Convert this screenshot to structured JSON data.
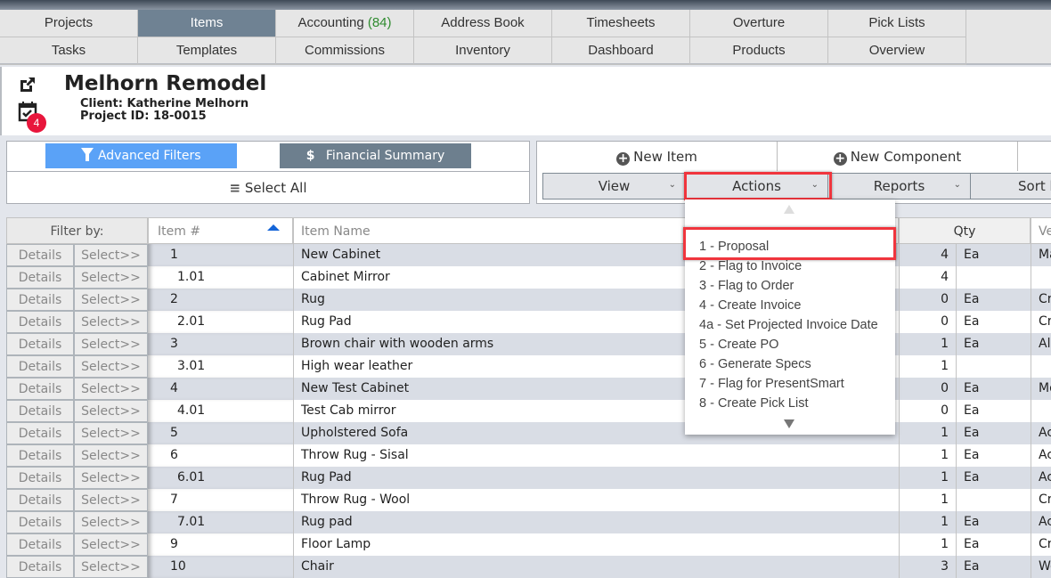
{
  "nav": {
    "row1": [
      {
        "label": "Projects",
        "active": false
      },
      {
        "label": "Items",
        "active": true
      },
      {
        "label": "Accounting",
        "count": "(84)",
        "active": false
      },
      {
        "label": "Address Book",
        "active": false
      },
      {
        "label": "Timesheets",
        "active": false
      },
      {
        "label": "Overture",
        "active": false
      },
      {
        "label": "Pick Lists",
        "active": false
      }
    ],
    "row2": [
      {
        "label": "Tasks"
      },
      {
        "label": "Templates"
      },
      {
        "label": "Commissions"
      },
      {
        "label": "Inventory"
      },
      {
        "label": "Dashboard"
      },
      {
        "label": "Products"
      },
      {
        "label": "Overview"
      }
    ]
  },
  "project": {
    "title": "Melhorn Remodel",
    "client": "Client: Katherine Melhorn",
    "project_id": "Project ID: 18-0015",
    "task_badge": "4"
  },
  "toolbar": {
    "advanced_filters": "Advanced Filters",
    "financial_summary": "Financial Summary",
    "select_all": "Select All",
    "new_item": "New Item",
    "new_component": "New Component",
    "view": "View",
    "actions": "Actions",
    "reports": "Reports",
    "sort_by": "Sort by"
  },
  "actions_menu": {
    "items": [
      "1 - Proposal",
      "2 - Flag to Invoice",
      "3 - Flag to Order",
      "4 - Create Invoice",
      "4a - Set Projected Invoice Date",
      "5 - Create PO",
      "6 - Generate Specs",
      "7 - Flag for PresentSmart",
      "8 - Create Pick List"
    ],
    "highlighted": "1 - Proposal"
  },
  "table": {
    "filter_label": "Filter by:",
    "headers": {
      "item_no": "Item #",
      "item_name": "Item Name",
      "qty": "Qty",
      "vendor": "Ve"
    },
    "details_label": "Details",
    "select_label": "Select>>",
    "rows": [
      {
        "no": "1",
        "name": "New Cabinet",
        "qty": "4",
        "unit": "Ea",
        "vendor": "Ma"
      },
      {
        "no": "1.01",
        "name": "Cabinet Mirror",
        "qty": "4",
        "unit": "",
        "vendor": ""
      },
      {
        "no": "2",
        "name": "Rug",
        "qty": "0",
        "unit": "Ea",
        "vendor": "Cr"
      },
      {
        "no": "2.01",
        "name": "Rug Pad",
        "qty": "0",
        "unit": "Ea",
        "vendor": "Cr"
      },
      {
        "no": "3",
        "name": "Brown chair with wooden arms",
        "qty": "1",
        "unit": "Ea",
        "vendor": "Al"
      },
      {
        "no": "3.01",
        "name": "High wear leather",
        "qty": "1",
        "unit": "",
        "vendor": ""
      },
      {
        "no": "4",
        "name": "New Test Cabinet",
        "qty": "0",
        "unit": "Ea",
        "vendor": "Mo"
      },
      {
        "no": "4.01",
        "name": "Test Cab mirror",
        "qty": "0",
        "unit": "Ea",
        "vendor": ""
      },
      {
        "no": "5",
        "name": "Upholstered Sofa",
        "qty": "1",
        "unit": "Ea",
        "vendor": "Ac"
      },
      {
        "no": "6",
        "name": "Throw Rug - Sisal",
        "qty": "1",
        "unit": "Ea",
        "vendor": "Ac"
      },
      {
        "no": "6.01",
        "name": "Rug Pad",
        "qty": "1",
        "unit": "Ea",
        "vendor": "Ac"
      },
      {
        "no": "7",
        "name": "Throw Rug - Wool",
        "qty": "1",
        "unit": "",
        "vendor": "Cr"
      },
      {
        "no": "7.01",
        "name": "Rug pad",
        "qty": "1",
        "unit": "Ea",
        "vendor": "Ac"
      },
      {
        "no": "9",
        "name": "Floor Lamp",
        "qty": "1",
        "unit": "Ea",
        "vendor": "Cr"
      },
      {
        "no": "10",
        "name": "Chair",
        "qty": "3",
        "unit": "Ea",
        "vendor": "We"
      }
    ]
  },
  "colors": {
    "active_tab": "#6f8293",
    "advanced_filters": "#5aa2f7",
    "financial_summary": "#6d7f8e",
    "highlight": "#f0353d",
    "badge": "#e8163c",
    "row_alt": "#d9dde5"
  }
}
